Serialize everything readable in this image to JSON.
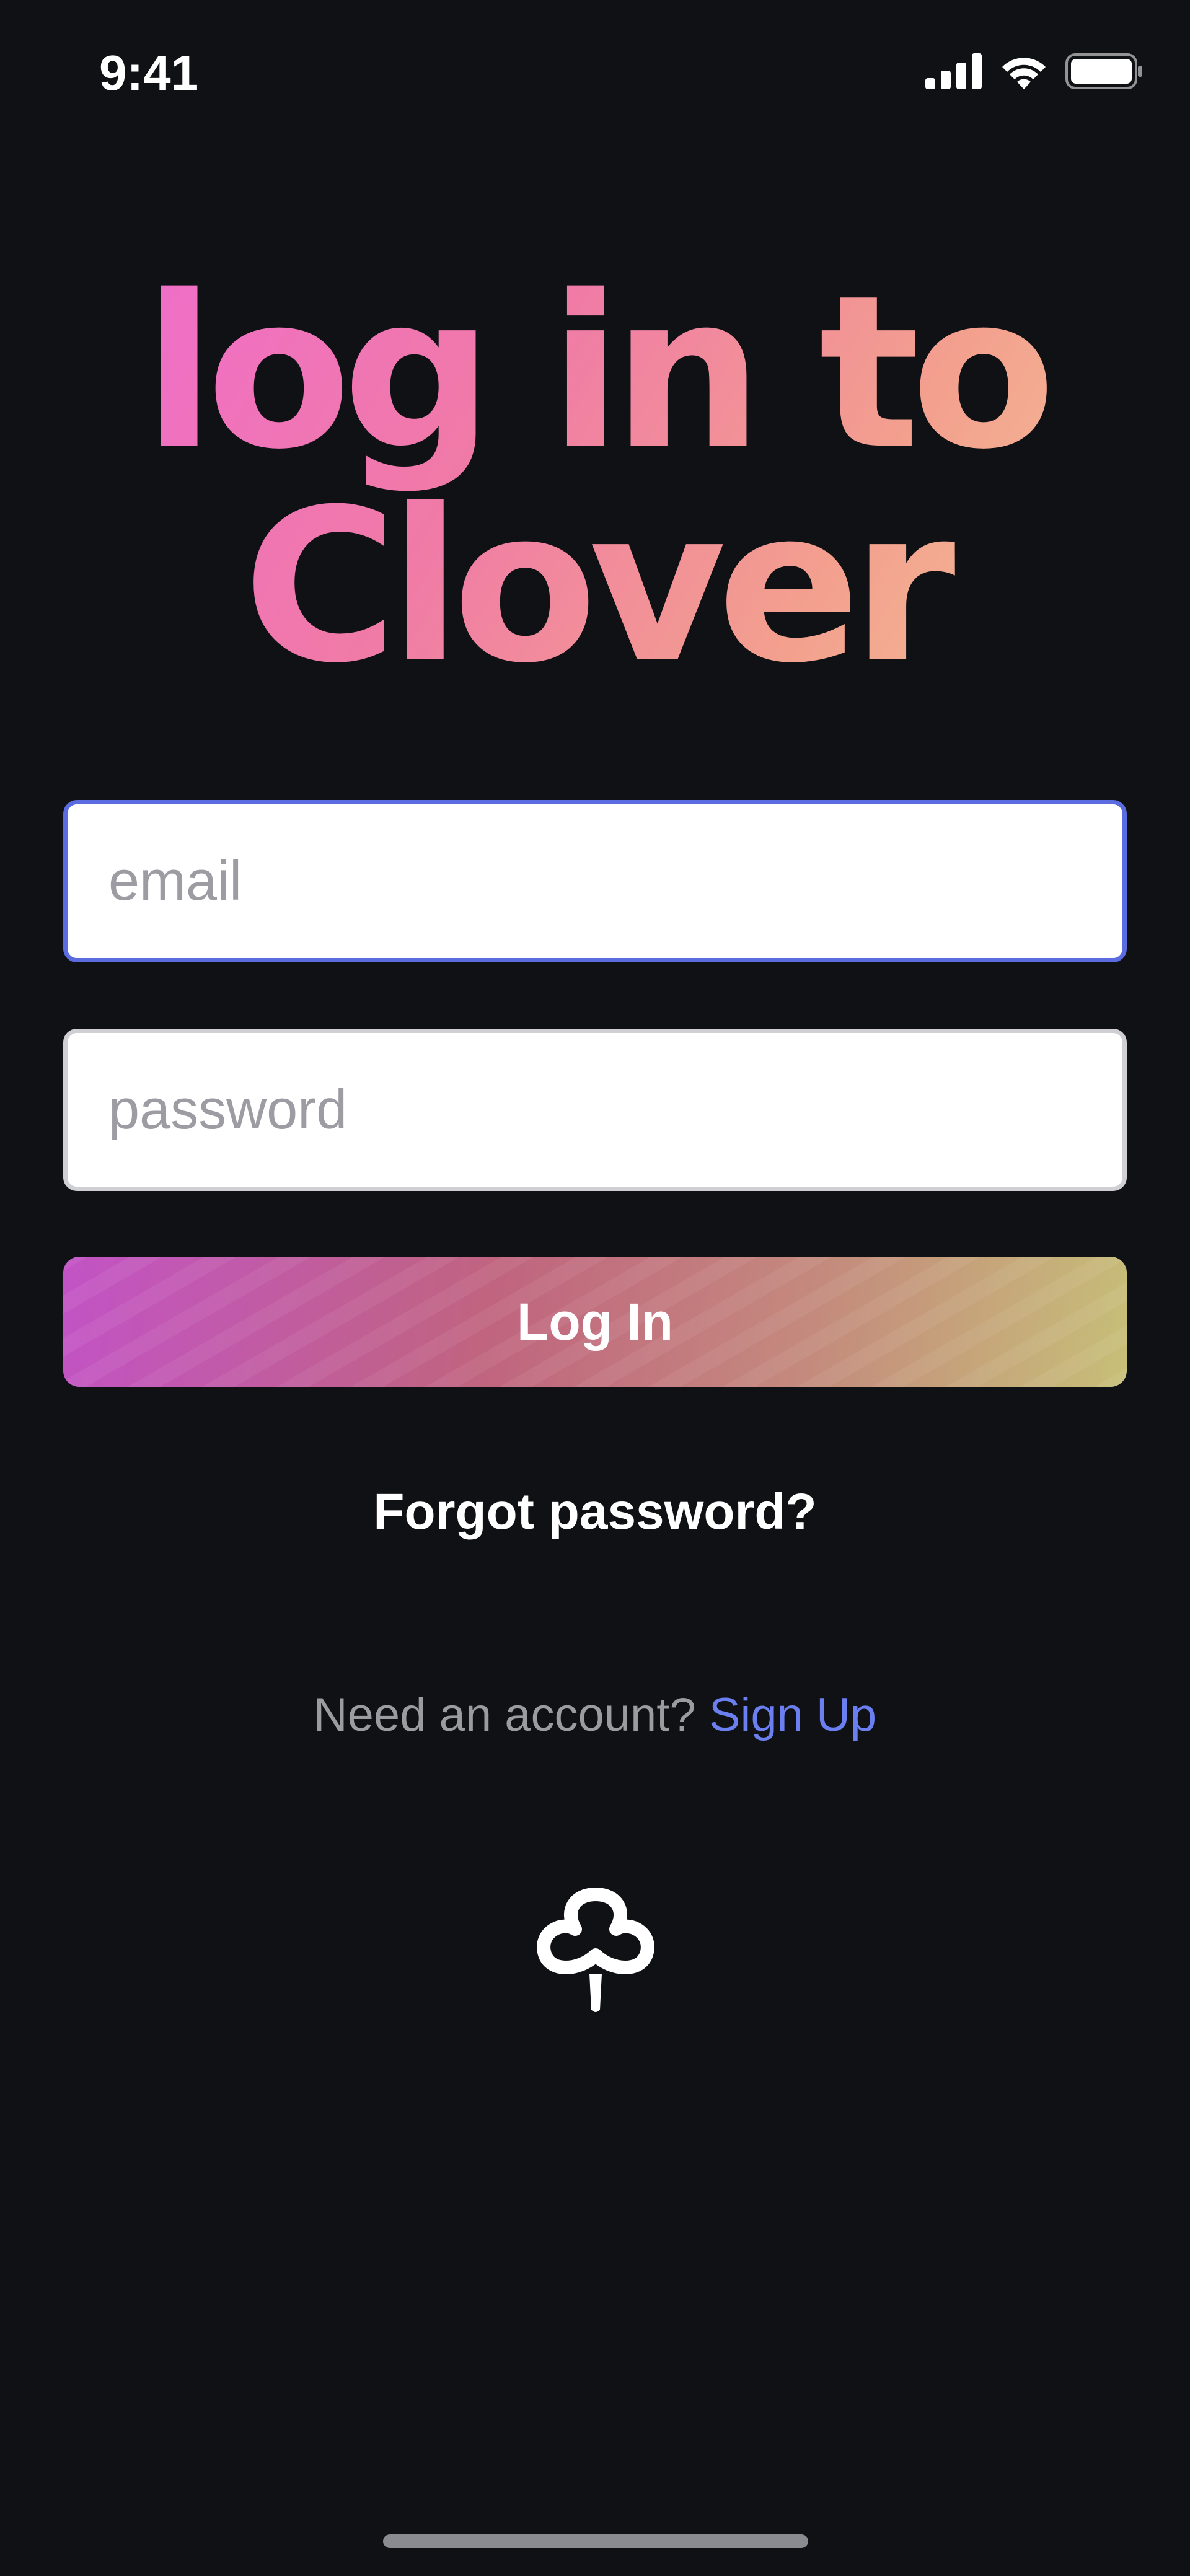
{
  "status_bar": {
    "time": "9:41",
    "icons": [
      "cellular-signal-icon",
      "wifi-icon",
      "battery-icon"
    ]
  },
  "headline": {
    "line1": "log in to",
    "line2": "Clover"
  },
  "form": {
    "email_placeholder": "email",
    "email_value": "",
    "password_placeholder": "password",
    "password_value": "",
    "login_label": "Log In"
  },
  "links": {
    "forgot_password": "Forgot password?",
    "signup_prompt": "Need an account?",
    "signup_link": "Sign Up"
  },
  "logo": {
    "icon": "clover-icon"
  },
  "colors": {
    "background": "#101115",
    "accent_focus": "#5b6be0",
    "link": "#6b7ff0",
    "gradient_start": "#ef6ad4",
    "gradient_end": "#f2c89a"
  }
}
